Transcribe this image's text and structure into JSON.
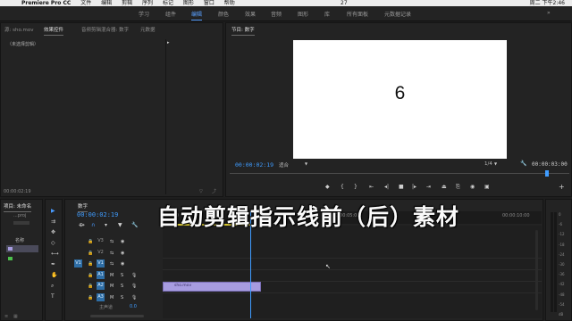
{
  "menubar": {
    "app": "Premiere Pro CC",
    "items": [
      "文件",
      "编辑",
      "剪辑",
      "序列",
      "标记",
      "图形",
      "窗口",
      "帮助"
    ],
    "clock": "周二 下午2:46",
    "battery": "27"
  },
  "workspaces": [
    {
      "label": "学习",
      "active": false
    },
    {
      "label": "组件",
      "active": false
    },
    {
      "label": "编辑",
      "active": true
    },
    {
      "label": "颜色",
      "active": false
    },
    {
      "label": "效果",
      "active": false
    },
    {
      "label": "音频",
      "active": false
    },
    {
      "label": "图形",
      "active": false
    },
    {
      "label": "库",
      "active": false
    },
    {
      "label": "所有面板",
      "active": false
    },
    {
      "label": "元数据记录",
      "active": false
    }
  ],
  "source_panel": {
    "tabs": [
      "源: sho.mov",
      "效果控件",
      "音频剪辑混合器: 数字",
      "元数据"
    ],
    "active_tab": "效果控件",
    "no_clip_text": "（未选择剪辑）",
    "timecode": "00:00:02:19"
  },
  "program_monitor": {
    "title": "节目: 数字",
    "frame_text": "6",
    "timecode": "00:00:02:19",
    "fit": "适合",
    "resolution": "1/4",
    "duration": "00:00:03:00",
    "playhead_fraction": 0.93
  },
  "project_panel": {
    "tab": "项目: 未命名",
    "file": "...proj",
    "column": "名称"
  },
  "timeline": {
    "sequence_tab": "数字",
    "timecode": "00:00:02:19",
    "ruler_labels": [
      ":00:00",
      "00:00:05:00",
      "00:00:10:00"
    ],
    "tracks": [
      {
        "name": "V3",
        "type": "video"
      },
      {
        "name": "V2",
        "type": "video"
      },
      {
        "name": "V1",
        "type": "video",
        "source": "V1"
      },
      {
        "name": "A1",
        "type": "audio"
      },
      {
        "name": "A2",
        "type": "audio"
      },
      {
        "name": "A3",
        "type": "audio"
      }
    ],
    "master_label": "主声道",
    "master_value": "0.0",
    "clip_label": "sho.mov",
    "playhead_fraction": 0.23
  },
  "meter_labels": [
    "0",
    "-6",
    "-12",
    "-18",
    "-24",
    "-30",
    "-36",
    "-42",
    "-48",
    "-54",
    "dB"
  ],
  "caption": "自动剪辑指示线前（后）素材",
  "colors": {
    "accent": "#3f9cff",
    "clip": "#a79ce0",
    "monitor_bg": "#ffffff"
  }
}
